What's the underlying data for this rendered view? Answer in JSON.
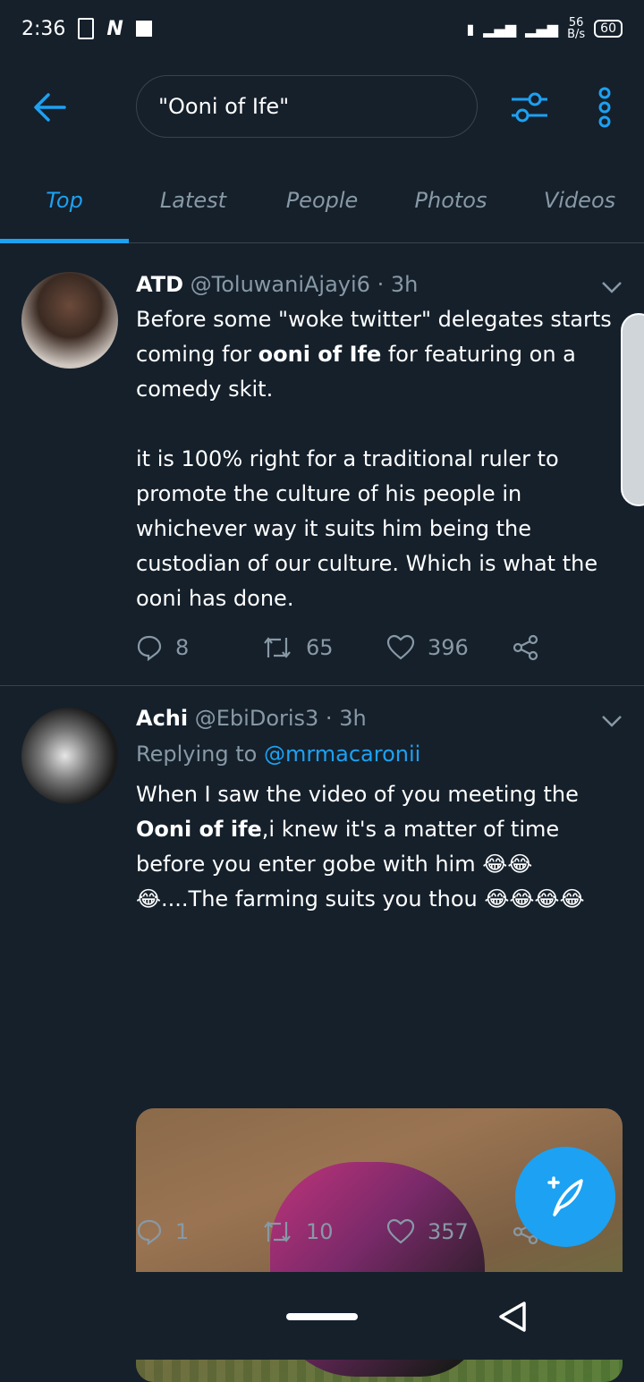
{
  "status_bar": {
    "time": "2:36",
    "speed_value": "56",
    "speed_unit": "B/s",
    "battery": "60"
  },
  "search": {
    "query": "\"Ooni of Ife\""
  },
  "tabs": [
    {
      "label": "Top",
      "active": true
    },
    {
      "label": "Latest",
      "active": false
    },
    {
      "label": "People",
      "active": false
    },
    {
      "label": "Photos",
      "active": false
    },
    {
      "label": "Videos",
      "active": false
    }
  ],
  "tweets": [
    {
      "name": "ATD",
      "handle": "@ToluwaniAjayi6 · 3h",
      "text_before": "Before some \"woke twitter\" delegates starts coming for ",
      "text_highlight": "ooni of Ife",
      "text_after": " for featuring on a comedy skit.\n\nit is 100% right for a traditional ruler to promote the culture of his people in whichever way it suits him being the custodian of our culture. Which is what the ooni has done.",
      "replies": "8",
      "retweets": "65",
      "likes": "396"
    },
    {
      "name": "Achi",
      "handle": "@EbiDoris3 · 3h",
      "replying_to_label": "Replying to",
      "replying_to_handle": "@mrmacaronii",
      "text_before": "When I saw the video of you meeting the ",
      "text_highlight": "Ooni of ife",
      "text_after": ",i knew it's a matter of time before you enter gobe with him 😂😂😂....The farming suits you thou 😂😂😂😂",
      "replies": "1",
      "retweets": "10",
      "likes": "357"
    }
  ],
  "colors": {
    "background": "#15202b",
    "accent": "#1da1f2",
    "muted": "#8899a6",
    "divider": "#38444d"
  },
  "icons": [
    "back-arrow-icon",
    "filter-icon",
    "more-icon",
    "chevron-down-icon",
    "reply-icon",
    "retweet-icon",
    "like-icon",
    "share-icon",
    "compose-icon"
  ]
}
